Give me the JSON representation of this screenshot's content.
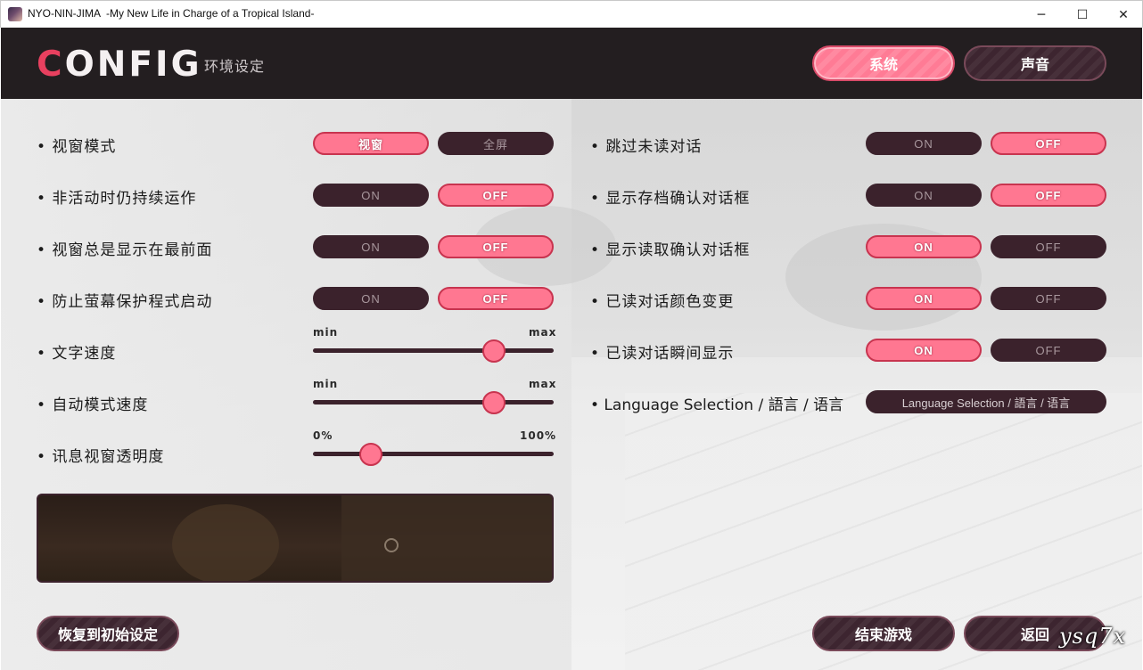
{
  "window": {
    "title": "NYO-NIN-JIMA  -My New Life in Charge of a Tropical Island-",
    "minimize_glyph": "─",
    "maximize_glyph": "☐",
    "close_glyph": "✕"
  },
  "header": {
    "logo_first": "C",
    "logo_rest": "ONFIG",
    "subtitle": "环境设定",
    "tabs": [
      {
        "label": "系统",
        "active": true
      },
      {
        "label": "声音",
        "active": false
      }
    ]
  },
  "left_settings": [
    {
      "label": "• 视窗模式",
      "options": [
        {
          "label": "视窗",
          "selected": true
        },
        {
          "label": "全屏",
          "selected": false
        }
      ]
    },
    {
      "label": "• 非活动时仍持续运作",
      "options": [
        {
          "label": "ON",
          "selected": false
        },
        {
          "label": "OFF",
          "selected": true
        }
      ]
    },
    {
      "label": "• 视窗总是显示在最前面",
      "options": [
        {
          "label": "ON",
          "selected": false
        },
        {
          "label": "OFF",
          "selected": true
        }
      ]
    },
    {
      "label": "• 防止萤幕保护程式启动",
      "options": [
        {
          "label": "ON",
          "selected": false
        },
        {
          "label": "OFF",
          "selected": true
        }
      ]
    }
  ],
  "sliders": [
    {
      "label": "• 文字速度",
      "min_label": "min",
      "max_label": "max",
      "value": 0.75
    },
    {
      "label": "• 自动模式速度",
      "min_label": "min",
      "max_label": "max",
      "value": 0.75
    },
    {
      "label": "• 讯息视窗透明度",
      "min_label": "0%",
      "max_label": "100%",
      "value": 0.24
    }
  ],
  "right_settings": [
    {
      "label": "• 跳过未读对话",
      "options": [
        {
          "label": "ON",
          "selected": false
        },
        {
          "label": "OFF",
          "selected": true
        }
      ]
    },
    {
      "label": "• 显示存档确认对话框",
      "options": [
        {
          "label": "ON",
          "selected": false
        },
        {
          "label": "OFF",
          "selected": true
        }
      ]
    },
    {
      "label": "• 显示读取确认对话框",
      "options": [
        {
          "label": "ON",
          "selected": true
        },
        {
          "label": "OFF",
          "selected": false
        }
      ]
    },
    {
      "label": "• 已读对话颜色变更",
      "options": [
        {
          "label": "ON",
          "selected": true
        },
        {
          "label": "OFF",
          "selected": false
        }
      ]
    },
    {
      "label": "• 已读对话瞬间显示",
      "options": [
        {
          "label": "ON",
          "selected": true
        },
        {
          "label": "OFF",
          "selected": false
        }
      ]
    }
  ],
  "language": {
    "label": "• Language Selection / 語言 / 语言",
    "button": "Language Selection / 語言 / 语言"
  },
  "buttons": {
    "reset": "恢复到初始设定",
    "quit": "结束游戏",
    "back": "返回"
  },
  "watermark": "ysq7x",
  "colors": {
    "accent": "#ff7791",
    "dark": "#3b222c",
    "header": "#231e20",
    "logo_accent": "#e8405f"
  }
}
